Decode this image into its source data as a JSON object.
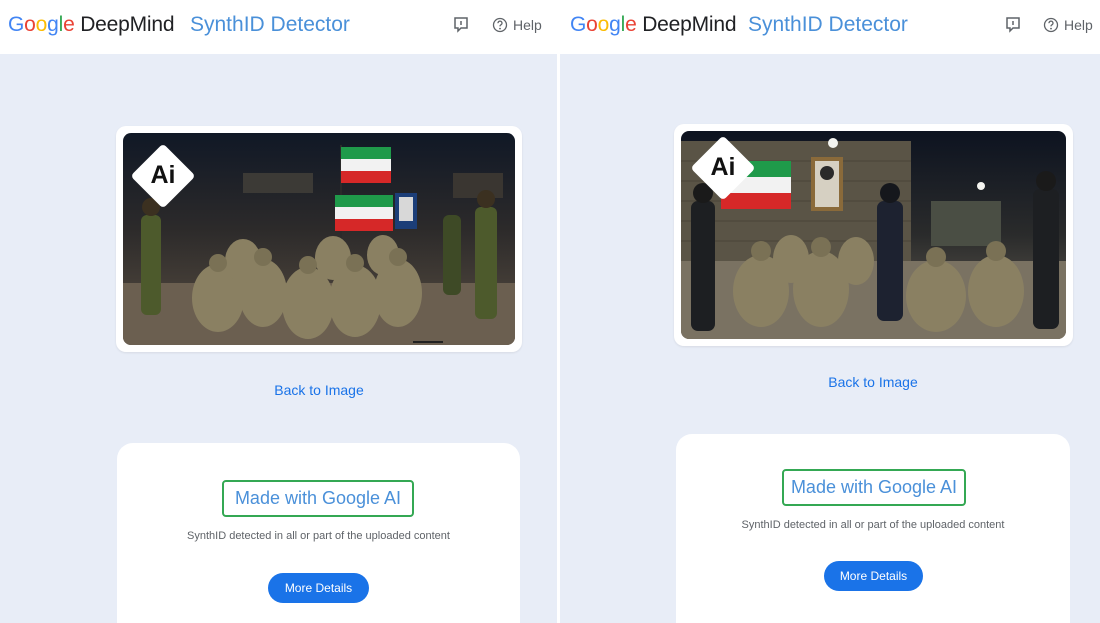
{
  "brand": {
    "google": "Google",
    "deepmind": "DeepMind"
  },
  "product": "SynthID Detector",
  "header": {
    "help_label": "Help",
    "feedback_icon": "feedback-flag-icon",
    "help_icon": "question-circle-icon"
  },
  "panels": [
    {
      "ai_badge": "Ai",
      "back_link": "Back to Image",
      "result": {
        "title": "Made with Google AI",
        "description": "SynthID detected in all or part of the uploaded content",
        "button": "More Details"
      }
    },
    {
      "ai_badge": "Ai",
      "back_link": "Back to Image",
      "result": {
        "title": "Made with Google AI",
        "description": "SynthID detected in all or part of the uploaded content",
        "button": "More Details"
      }
    }
  ],
  "colors": {
    "accent": "#4a90d9",
    "highlight_border": "#34a853",
    "button": "#1a73e8",
    "content_bg": "#e8edf7"
  }
}
